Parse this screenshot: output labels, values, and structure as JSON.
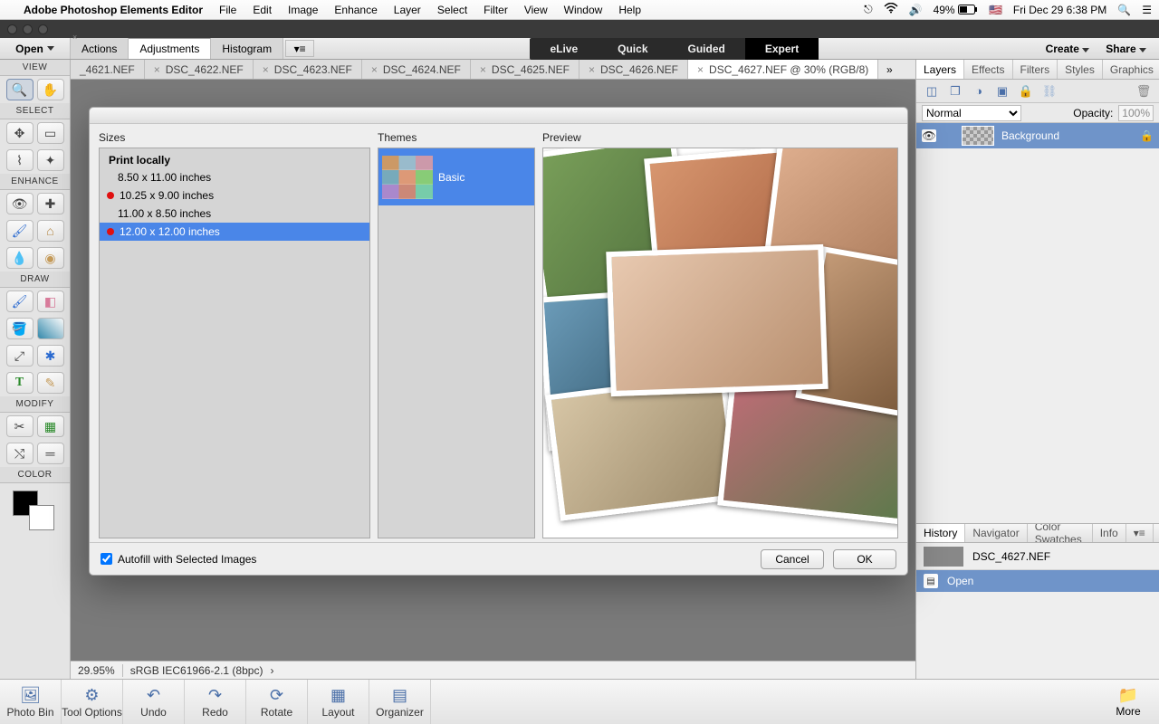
{
  "menubar": {
    "appname": "Adobe Photoshop Elements Editor",
    "items": [
      "File",
      "Edit",
      "Image",
      "Enhance",
      "Layer",
      "Select",
      "Filter",
      "View",
      "Window",
      "Help"
    ],
    "battery": "49%",
    "clock": "Fri Dec 29  6:38 PM"
  },
  "topbar": {
    "open": "Open",
    "panel_tabs": [
      "Actions",
      "Adjustments",
      "Histogram"
    ],
    "panel_active": 1,
    "modes": [
      "eLive",
      "Quick",
      "Guided",
      "Expert"
    ],
    "mode_active": 3,
    "create": "Create",
    "share": "Share"
  },
  "doctabs": [
    {
      "label": "_4621.NEF"
    },
    {
      "label": "DSC_4622.NEF"
    },
    {
      "label": "DSC_4623.NEF"
    },
    {
      "label": "DSC_4624.NEF"
    },
    {
      "label": "DSC_4625.NEF"
    },
    {
      "label": "DSC_4626.NEF"
    },
    {
      "label": "DSC_4627.NEF @ 30% (RGB/8)",
      "active": true
    }
  ],
  "toolcol": {
    "groups": [
      "VIEW",
      "SELECT",
      "ENHANCE",
      "DRAW",
      "MODIFY",
      "COLOR"
    ]
  },
  "rightpanel": {
    "top_tabs": [
      "Layers",
      "Effects",
      "Filters",
      "Styles",
      "Graphics"
    ],
    "blend": "Normal",
    "opacity_label": "Opacity:",
    "opacity": "100%",
    "layer_name": "Background",
    "bottom_tabs": [
      "History",
      "Navigator",
      "Color Swatches",
      "Info"
    ],
    "hist_file": "DSC_4627.NEF",
    "hist_step": "Open"
  },
  "status": {
    "zoom": "29.95%",
    "profile": "sRGB IEC61966-2.1 (8bpc)"
  },
  "bottombar": {
    "items": [
      "Photo Bin",
      "Tool Options",
      "Undo",
      "Redo",
      "Rotate",
      "Layout",
      "Organizer"
    ],
    "more": "More"
  },
  "dialog": {
    "sizes_hdr": "Sizes",
    "themes_hdr": "Themes",
    "preview_hdr": "Preview",
    "group_title": "Print locally",
    "sizes": [
      {
        "label": "8.50 x 11.00 inches"
      },
      {
        "label": "10.25 x 9.00 inches",
        "flag": true
      },
      {
        "label": "11.00 x 8.50 inches"
      },
      {
        "label": "12.00 x 12.00 inches",
        "flag": true,
        "selected": true
      }
    ],
    "theme": "Basic",
    "autofill": "Autofill with Selected Images",
    "cancel": "Cancel",
    "ok": "OK"
  }
}
